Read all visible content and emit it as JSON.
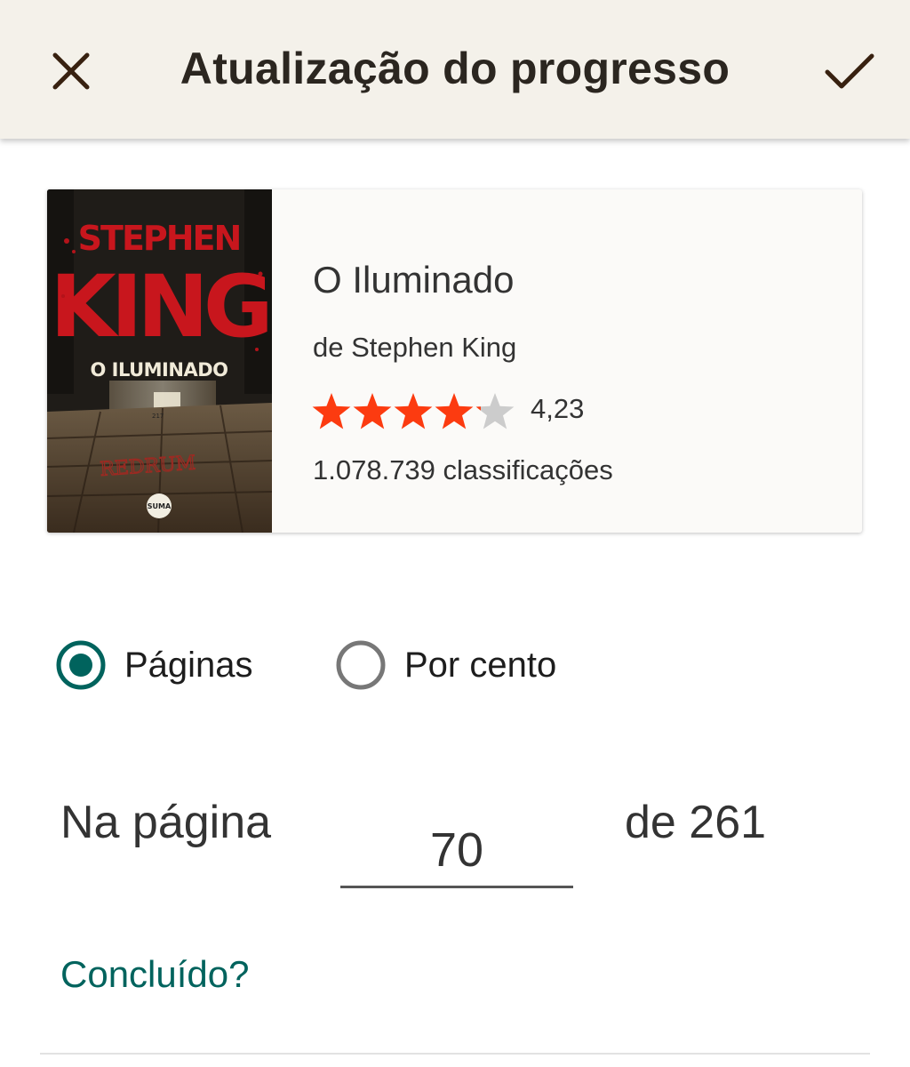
{
  "header": {
    "title": "Atualização do progresso",
    "close_icon": "close-icon",
    "confirm_icon": "checkmark-icon",
    "background": "#f4f1ea"
  },
  "book": {
    "title": "O Iluminado",
    "author": "de Stephen King",
    "rating_value": "4,23",
    "rating_stars": 4.23,
    "ratings_count": "1.078.739 classificações",
    "cover": {
      "author_line1": "STEPHEN",
      "author_line2": "KING",
      "title": "O ILUMINADO",
      "door_number": "217",
      "scrawl": "REDRUM",
      "publisher": "SUMA"
    },
    "star_color": "#fc3b10",
    "star_empty_color": "#cccccc"
  },
  "progress_type": {
    "options": [
      {
        "label": "Páginas",
        "selected": true
      },
      {
        "label": "Por cento",
        "selected": false
      }
    ],
    "accent": "#00635d"
  },
  "progress": {
    "prefix": "Na página",
    "current_page": "70",
    "total": "de 261"
  },
  "finished_link": "Concluído?"
}
